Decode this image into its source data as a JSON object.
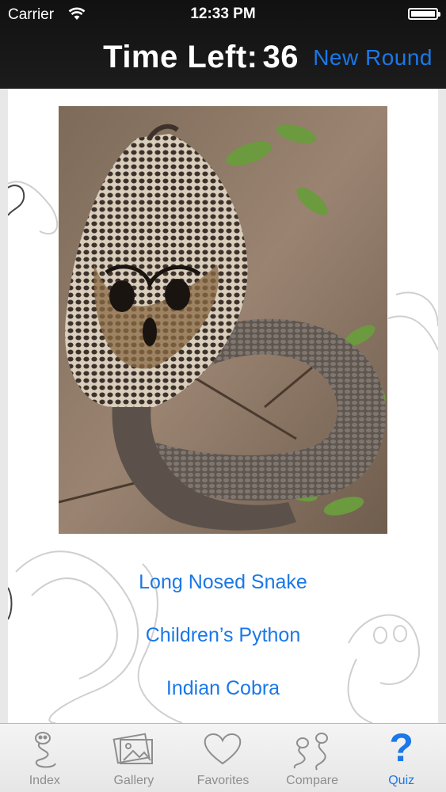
{
  "status_bar": {
    "carrier": "Carrier",
    "time": "12:33 PM"
  },
  "header": {
    "time_left_label": "Time Left:",
    "time_left_value": "36",
    "new_round_label": "New Round"
  },
  "quiz": {
    "image": "indian-cobra-photo",
    "answers": [
      "Long Nosed Snake",
      "Children’s Python",
      "Indian Cobra"
    ]
  },
  "tabbar": {
    "tabs": [
      {
        "label": "Index",
        "icon": "snake-icon",
        "active": false
      },
      {
        "label": "Gallery",
        "icon": "photos-icon",
        "active": false
      },
      {
        "label": "Favorites",
        "icon": "heart-icon",
        "active": false
      },
      {
        "label": "Compare",
        "icon": "two-snakes-icon",
        "active": false
      },
      {
        "label": "Quiz",
        "icon": "question-mark-icon",
        "active": true
      }
    ]
  },
  "colors": {
    "accent": "#1a78e8",
    "header_bg": "#1a1a1a",
    "tab_inactive": "#8e8e8e"
  }
}
